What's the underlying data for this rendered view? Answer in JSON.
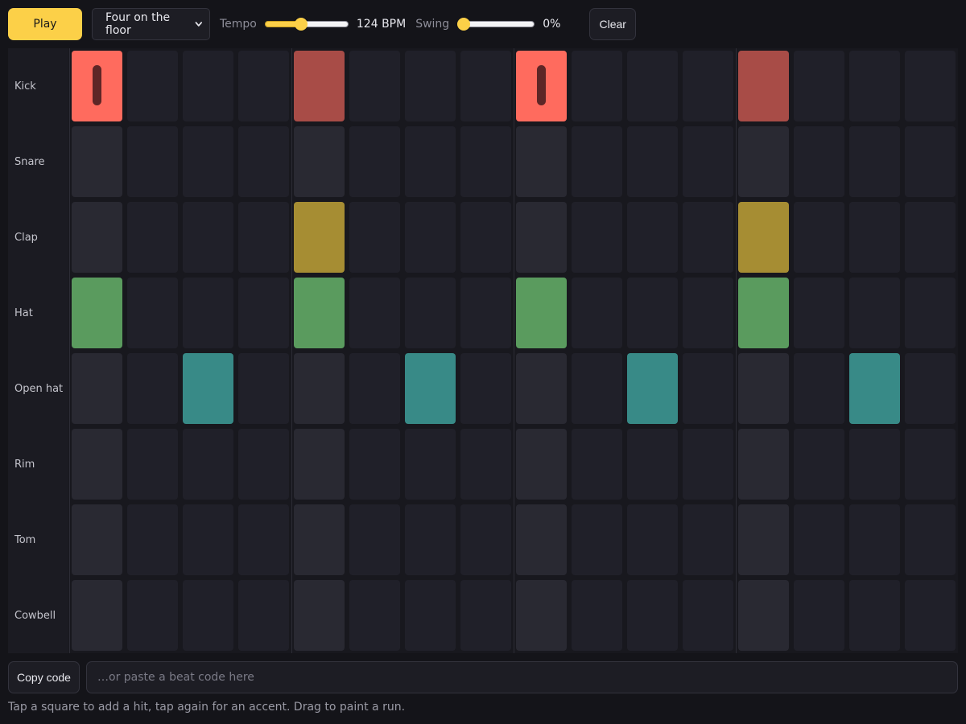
{
  "toolbar": {
    "play_label": "Play",
    "pattern": {
      "selected": "Four on the floor"
    },
    "tempo": {
      "label": "Tempo",
      "value": 124,
      "min": 40,
      "max": 240,
      "value_text": "124 BPM"
    },
    "swing": {
      "label": "Swing",
      "value": 0,
      "min": 0,
      "max": 100,
      "value_text": "0%"
    },
    "clear_label": "Clear"
  },
  "sequencer": {
    "steps": 16,
    "rows": [
      {
        "label": "Kick",
        "color": "#ff6b5e",
        "steps": [
          2,
          0,
          0,
          0,
          1,
          0,
          0,
          0,
          2,
          0,
          0,
          0,
          1,
          0,
          0,
          0
        ]
      },
      {
        "label": "Snare",
        "color": "#e0566b",
        "steps": [
          0,
          0,
          0,
          0,
          0,
          0,
          0,
          0,
          0,
          0,
          0,
          0,
          0,
          0,
          0,
          0
        ]
      },
      {
        "label": "Clap",
        "color": "#a68d33",
        "steps": [
          0,
          0,
          0,
          0,
          1,
          0,
          0,
          0,
          0,
          0,
          0,
          0,
          1,
          0,
          0,
          0
        ]
      },
      {
        "label": "Hat",
        "color": "#5a9b5e",
        "steps": [
          1,
          0,
          0,
          0,
          1,
          0,
          0,
          0,
          1,
          0,
          0,
          0,
          1,
          0,
          0,
          0
        ]
      },
      {
        "label": "Open hat",
        "color": "#388a87",
        "steps": [
          0,
          0,
          1,
          0,
          0,
          0,
          1,
          0,
          0,
          0,
          1,
          0,
          0,
          0,
          1,
          0
        ]
      },
      {
        "label": "Rim",
        "color": "#7d6bd1",
        "steps": [
          0,
          0,
          0,
          0,
          0,
          0,
          0,
          0,
          0,
          0,
          0,
          0,
          0,
          0,
          0,
          0
        ]
      },
      {
        "label": "Tom",
        "color": "#c07a3d",
        "steps": [
          0,
          0,
          0,
          0,
          0,
          0,
          0,
          0,
          0,
          0,
          0,
          0,
          0,
          0,
          0,
          0
        ]
      },
      {
        "label": "Cowbell",
        "color": "#4f7fc4",
        "steps": [
          0,
          0,
          0,
          0,
          0,
          0,
          0,
          0,
          0,
          0,
          0,
          0,
          0,
          0,
          0,
          0
        ]
      }
    ],
    "normal_colors": {
      "Kick": "#a84c47",
      "Clap": "#a68d33",
      "Hat": "#5a9b5e",
      "Open hat": "#388a87"
    }
  },
  "footer": {
    "copy_label": "Copy code",
    "code_input": {
      "value": "",
      "placeholder": "…or paste a beat code here"
    },
    "hint": "Tap a square to add a hit, tap again for an accent. Drag to paint a run."
  }
}
